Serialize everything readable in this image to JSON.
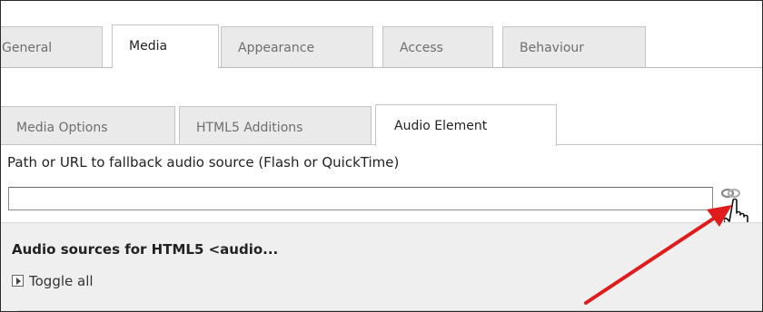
{
  "top_tabs": [
    {
      "label": "General",
      "active": false
    },
    {
      "label": "Media",
      "active": true
    },
    {
      "label": "Appearance",
      "active": false
    },
    {
      "label": "Access",
      "active": false
    },
    {
      "label": "Behaviour",
      "active": false
    }
  ],
  "sub_tabs": [
    {
      "label": "Media Options",
      "active": false
    },
    {
      "label": "HTML5 Additions",
      "active": false
    },
    {
      "label": "Audio Element",
      "active": true
    }
  ],
  "fallback": {
    "label": "Path or URL to fallback audio source (Flash or QuickTime)",
    "value": "",
    "browse_icon": "link-chain-icon",
    "cursor_icon": "hand-pointer-icon"
  },
  "sources_panel": {
    "title": "Audio sources for HTML5 <audio...",
    "toggle_label": "Toggle all"
  },
  "annotation": {
    "arrow_color": "#e01b1b"
  }
}
